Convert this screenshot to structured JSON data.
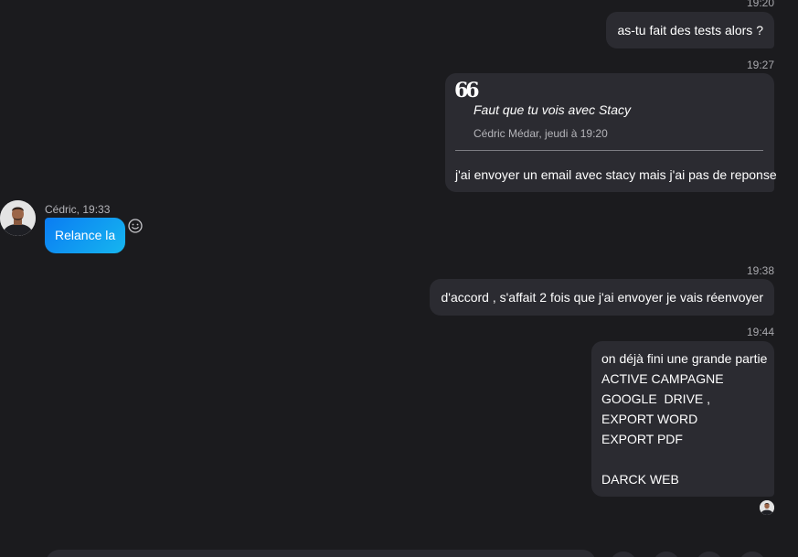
{
  "messages": {
    "m1": {
      "time": "19:20",
      "text": "as-tu fait des tests alors ?"
    },
    "m2": {
      "time": "19:27",
      "quote_icon": "quote-icon",
      "quoted_text": "Faut que tu vois avec Stacy",
      "quoted_meta": "Cédric Médar, jeudi à 19:20",
      "text": "j'ai envoyer un email avec stacy mais j'ai pas de reponse"
    },
    "incoming": {
      "sender_meta": "Cédric, 19:33",
      "text": "Relance la",
      "reaction_icon": "smiley-icon"
    },
    "m3": {
      "time": "19:38",
      "text": "d'accord , s'affait 2 fois que j'ai envoyer je vais réenvoyer"
    },
    "m4": {
      "time": "19:44",
      "lines": [
        "on déjà fini une grande partie",
        "ACTIVE CAMPAGNE",
        "GOOGLE  DRIVE ,",
        "EXPORT WORD",
        "EXPORT PDF",
        "",
        "DARCK WEB"
      ]
    }
  },
  "colors": {
    "background": "#1b1b1e",
    "bubble": "#2b2b31",
    "incoming_gradient_start": "#0a7cf3",
    "incoming_gradient_end": "#16b6ef"
  }
}
